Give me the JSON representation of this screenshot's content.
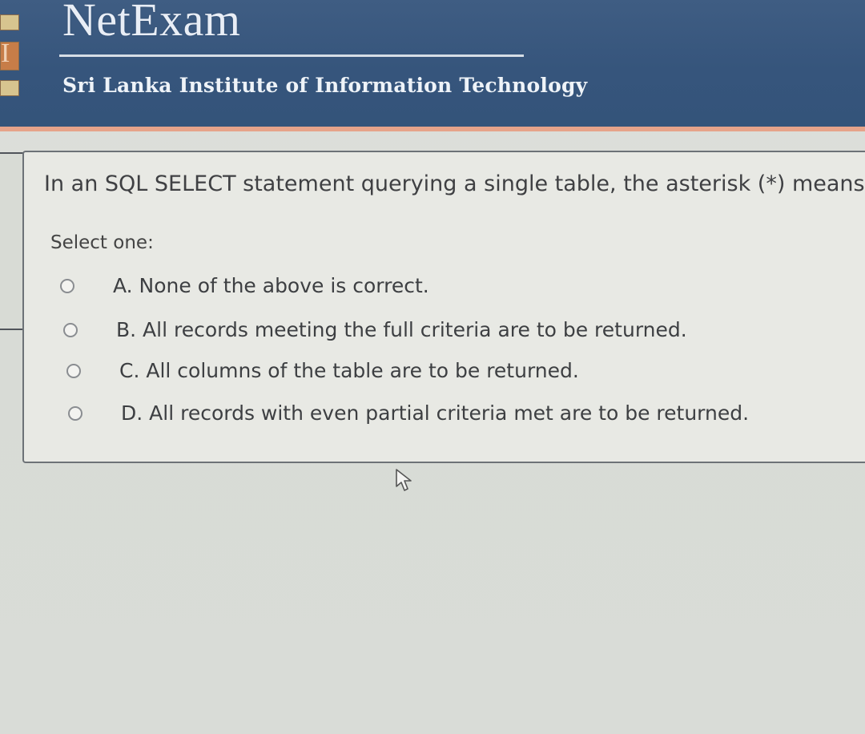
{
  "header": {
    "brand": "NetExam",
    "subtitle": "Sri Lanka Institute of Information Technology"
  },
  "question": {
    "text": "In an SQL SELECT statement querying a single table, the asterisk (*) means that:",
    "prompt": "Select one:",
    "options": [
      {
        "label": "A. None of the above is correct."
      },
      {
        "label": "B. All records meeting the full criteria are to be returned."
      },
      {
        "label": "C. All columns of the table are to be returned."
      },
      {
        "label": "D. All records with even partial criteria met are to be returned."
      }
    ]
  },
  "colors": {
    "header_bg": "#36557c",
    "accent_bar": "#e6a38a",
    "page_bg": "#d8dbd6",
    "card_border": "#6d7277"
  },
  "icons": {
    "logo": "institute-logo-icon",
    "pointer": "mouse-pointer-icon"
  }
}
